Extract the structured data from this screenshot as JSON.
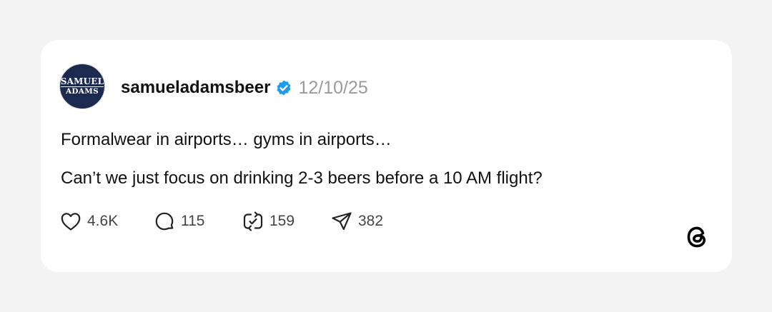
{
  "post": {
    "avatar": {
      "line1": "SAMUEL",
      "line2": "ADAMS"
    },
    "username": "samueladamsbeer",
    "verified_icon": "verified-badge-icon",
    "date": "12/10/25",
    "text_line_1": "Formalwear in airports… gyms in airports…",
    "text_line_2": "Can’t we just focus on drinking 2-3 beers before a 10 AM flight?",
    "actions": {
      "like_count": "4.6K",
      "reply_count": "115",
      "repost_count": "159",
      "share_count": "382"
    },
    "icons": [
      "heart-icon",
      "comment-icon",
      "repost-icon",
      "share-icon",
      "threads-logo-icon"
    ]
  },
  "colors": {
    "page_background": "#f3f3f3",
    "card_background": "#ffffff",
    "avatar_background": "#1c2a4f",
    "verified_blue": "#1d9bf0",
    "date_gray": "#9a9a9a",
    "text": "#111111"
  }
}
